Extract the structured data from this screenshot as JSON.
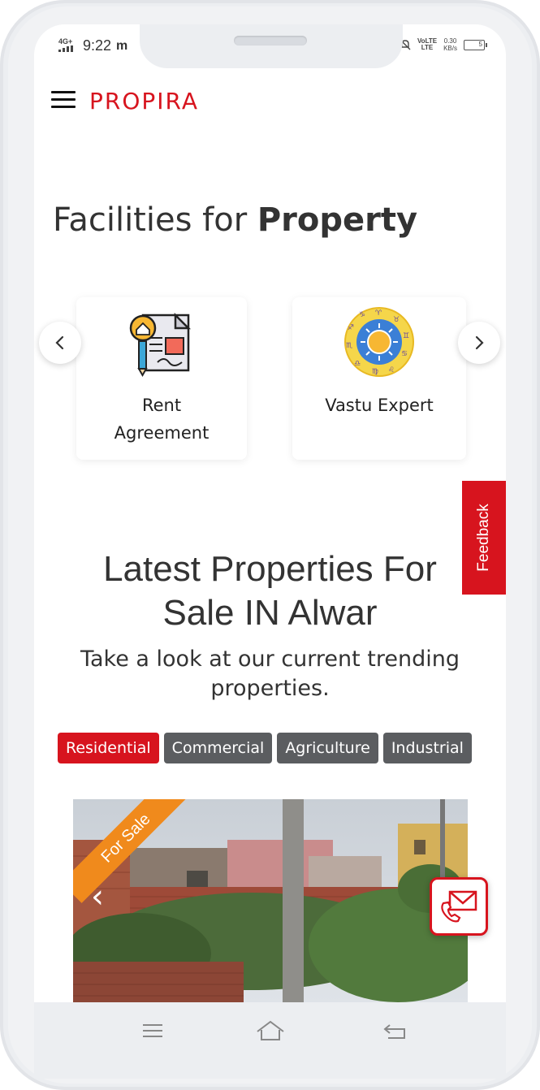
{
  "status_bar": {
    "network": "4G+",
    "time": "9:22",
    "notification": "m",
    "volte": "VoLTE",
    "volte_sub": "LTE",
    "speed_value": "0.30",
    "speed_unit": "KB/s",
    "battery": "5"
  },
  "header": {
    "logo": "PROPIRA",
    "brand_color": "#d7141e"
  },
  "facilities": {
    "title_normal": "Facilities for ",
    "title_bold": "Property",
    "cards": [
      {
        "label_line1": "Rent",
        "label_line2": "Agreement",
        "icon": "rent-agreement-icon"
      },
      {
        "label_line1": "Vastu Expert",
        "label_line2": "",
        "icon": "vastu-zodiac-icon"
      }
    ],
    "prev_icon": "chevron-left-icon",
    "next_icon": "chevron-right-icon"
  },
  "feedback": {
    "label": "Feedback"
  },
  "latest": {
    "title_line1": "Latest Properties For",
    "title_line2": "Sale IN Alwar",
    "subtitle_line1": "Take a look at our current trending",
    "subtitle_line2": "properties."
  },
  "tabs": [
    {
      "label": "Residential",
      "active": true
    },
    {
      "label": "Commercial",
      "active": false
    },
    {
      "label": "Agriculture",
      "active": false
    },
    {
      "label": "Industrial",
      "active": false
    }
  ],
  "listing": {
    "badge": "For Sale",
    "prev": "‹",
    "next": "›"
  },
  "accent_colors": {
    "red": "#d7141e",
    "orange": "#f08a1c",
    "tab_gray": "#5b5d60"
  }
}
